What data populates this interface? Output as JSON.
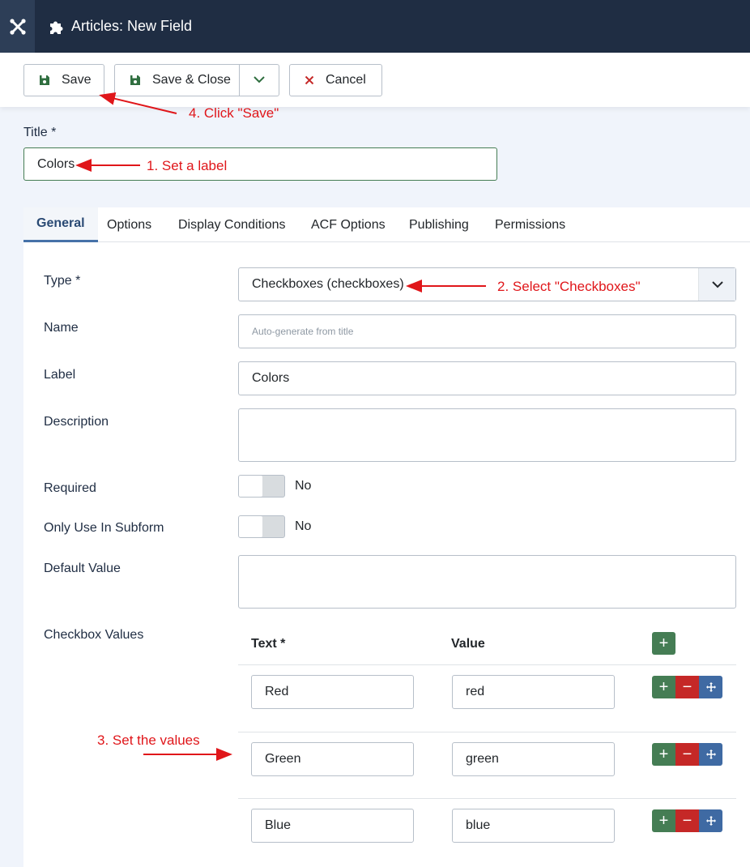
{
  "header": {
    "title": "Articles: New Field"
  },
  "toolbar": {
    "save_label": "Save",
    "save_close_label": "Save & Close",
    "cancel_label": "Cancel"
  },
  "title_field": {
    "label": "Title *",
    "value": "Colors"
  },
  "tabs": [
    {
      "label": "General"
    },
    {
      "label": "Options"
    },
    {
      "label": "Display Conditions"
    },
    {
      "label": "ACF Options"
    },
    {
      "label": "Publishing"
    },
    {
      "label": "Permissions"
    }
  ],
  "form": {
    "type": {
      "label": "Type *",
      "value": "Checkboxes (checkboxes)"
    },
    "name": {
      "label": "Name",
      "placeholder": "Auto-generate from title"
    },
    "field_label": {
      "label": "Label",
      "value": "Colors"
    },
    "description": {
      "label": "Description"
    },
    "required": {
      "label": "Required",
      "state": "No"
    },
    "only_subform": {
      "label": "Only Use In Subform",
      "state": "No"
    },
    "default_value": {
      "label": "Default Value"
    },
    "checkbox_values": {
      "label": "Checkbox Values",
      "col_text": "Text *",
      "col_value": "Value",
      "rows": [
        {
          "text": "Red",
          "value": "red"
        },
        {
          "text": "Green",
          "value": "green"
        },
        {
          "text": "Blue",
          "value": "blue"
        }
      ]
    }
  },
  "annotations": {
    "step1": "1. Set a label",
    "step2": "2. Select \"Checkboxes\"",
    "step3": "3. Set the values",
    "step4": "4. Click \"Save\""
  },
  "colors": {
    "header_bg": "#1f2d43",
    "success": "#457d54",
    "danger": "#c52827",
    "primary": "#3f6aa3",
    "annotation": "#e0161a"
  }
}
